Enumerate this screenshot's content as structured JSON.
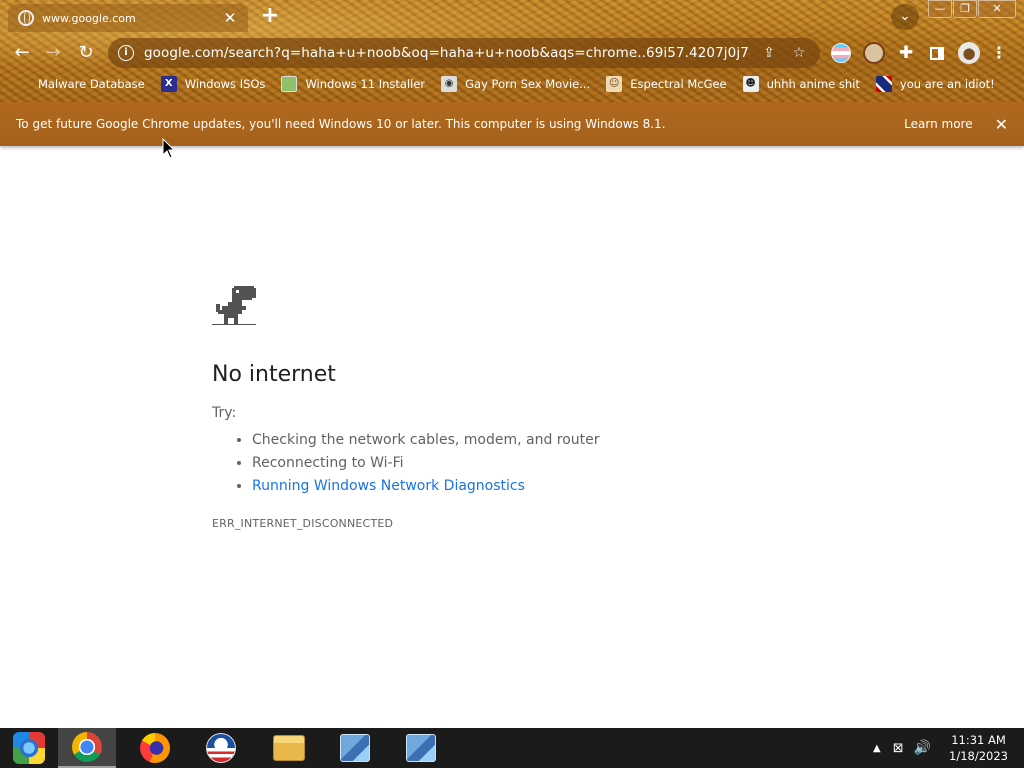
{
  "browser": {
    "tab_title": "www.google.com",
    "new_tab": "+",
    "url": "google.com/search?q=haha+u+noob&oq=haha+u+noob&aqs=chrome..69i57.4207j0j7&sourceid..."
  },
  "bookmarks": [
    {
      "label": "Malware Database",
      "icon": ""
    },
    {
      "label": "Windows ISOs",
      "icon": "X"
    },
    {
      "label": "Windows 11 Installer",
      "icon": ""
    },
    {
      "label": "Gay Porn Sex Movie...",
      "icon": ""
    },
    {
      "label": "Espectral McGee",
      "icon": ""
    },
    {
      "label": "uhhh anime shit",
      "icon": ""
    },
    {
      "label": "you are an idiot!",
      "icon": ""
    }
  ],
  "infobar": {
    "message": "To get future Google Chrome updates, you'll need Windows 10 or later. This computer is using Windows 8.1.",
    "learn_more": "Learn more"
  },
  "error_page": {
    "headline": "No internet",
    "try_label": "Try:",
    "suggestions": [
      "Checking the network cables, modem, and router",
      "Reconnecting to Wi-Fi",
      "Running Windows Network Diagnostics"
    ],
    "error_code": "ERR_INTERNET_DISCONNECTED"
  },
  "taskbar": {
    "time": "11:31 AM",
    "date": "1/18/2023"
  },
  "colors": {
    "theme": "#b9781c",
    "infobar": "#a8651d",
    "link": "#1a73e8",
    "taskbar": "#1b1b1b"
  }
}
